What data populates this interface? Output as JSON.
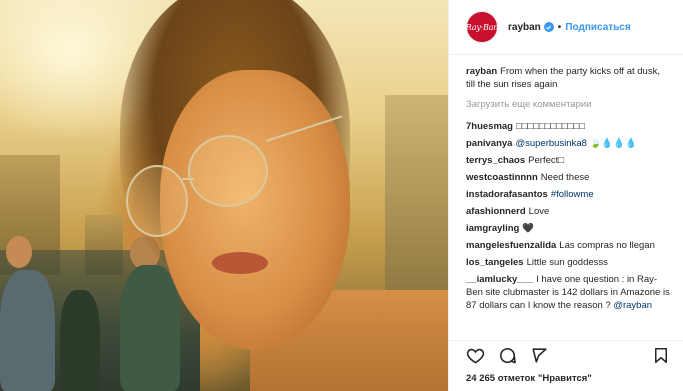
{
  "post": {
    "username": "rayban",
    "avatar_text": "Ray·Ban",
    "follow_label": "Подписаться",
    "dot": "•",
    "caption_user": "rayban",
    "caption_text": "From when the party kicks off at dusk, till the sun rises again",
    "load_more": "Загрузить еще комментарии",
    "likes": "24 265 отметок \"Нравится\"",
    "brand_color": "#c8102e",
    "accent_color": "#3897f0"
  },
  "comments": [
    {
      "user": "7huesmag",
      "text": "□□□□□□□□□□□□"
    },
    {
      "user": "panivanya",
      "mention": "@superbusinka8",
      "text": "🍃💧💧💧"
    },
    {
      "user": "terrys_chaos",
      "text": "Perfect□"
    },
    {
      "user": "westcoastinnnn",
      "text": "Need these"
    },
    {
      "user": "instadorafasantos",
      "mention": "#followme",
      "text": ""
    },
    {
      "user": "afashionnerd",
      "text": "Love"
    },
    {
      "user": "iamgrayling",
      "text": "🖤"
    },
    {
      "user": "mangelesfuenzalida",
      "text": "Las compras no llegan"
    },
    {
      "user": "los_tangeles",
      "text": "Little sun goddesss"
    },
    {
      "user": "__iamlucky___",
      "text": "I have one question : in Ray-Ben site clubmaster is 142 dollars in Amazone is 87 dollars can I know the reason ?",
      "mention": "@rayban"
    }
  ],
  "icons": [
    "heart-icon",
    "comment-icon",
    "share-icon",
    "bookmark-icon",
    "verified-badge-icon"
  ]
}
